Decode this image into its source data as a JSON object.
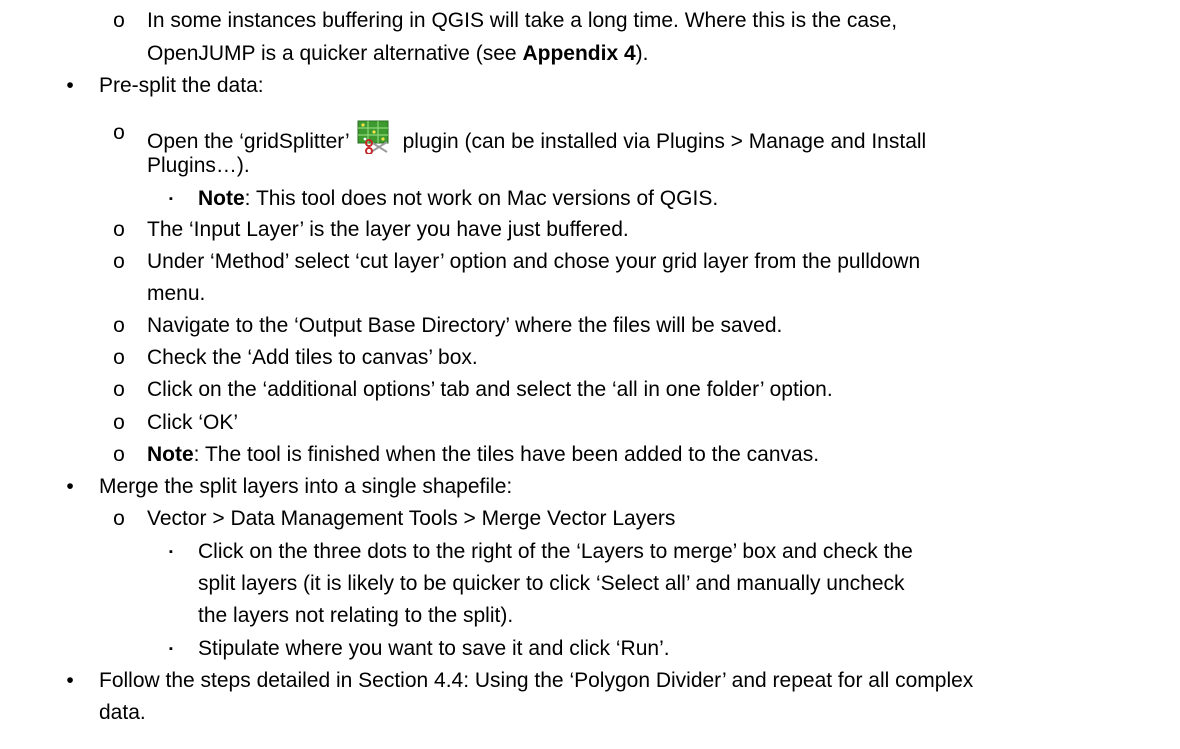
{
  "bullets": {
    "level1": "•",
    "level2": "o",
    "level3": "▪"
  },
  "intro": {
    "line1": "In some instances buffering in QGIS will take a long time.  Where this is the case,",
    "line2_pre": "OpenJUMP is a quicker alternative (see ",
    "line2_bold": "Appendix 4",
    "line2_post": ")."
  },
  "presplit": {
    "heading": "Pre-split the data:",
    "open_pre": "Open the ‘gridSplitter’ ",
    "open_post": " plugin (can be installed via Plugins > Manage and Install",
    "open_cont": "Plugins…).",
    "note_bold": "Note",
    "note_text": ": This tool does not work on Mac versions of QGIS.",
    "input_layer": "The ‘Input Layer’ is the layer you have just buffered.",
    "method_1": "Under ‘Method’ select ‘cut layer’ option and chose your grid layer from the pulldown",
    "method_2": "menu.",
    "navigate": "Navigate to the ‘Output Base Directory’ where the files will be saved.",
    "check": "Check the ‘Add tiles to canvas’ box.",
    "additional": "Click on the ‘additional options’ tab and select the ‘all in one folder’ option.",
    "ok": "Click ‘OK’",
    "note2_bold": "Note",
    "note2_text": ": The tool is finished when the tiles have been added to the canvas."
  },
  "merge": {
    "heading": "Merge the split layers into a single shapefile:",
    "path": "Vector > Data Management Tools > Merge Vector Layers",
    "step1_1": "Click on the three dots to the right of the ‘Layers to merge’ box and check the",
    "step1_2": "split layers (it is likely to be quicker to click ‘Select all’ and manually uncheck",
    "step1_3": "the layers not relating to the split).",
    "step2": "Stipulate where you want to save it and click ‘Run’."
  },
  "follow": {
    "line1": "Follow the steps detailed in Section 4.4: Using the ‘Polygon Divider’ and repeat for all complex",
    "line2": "data."
  },
  "icon_names": [
    "grid-splitter-plugin-icon"
  ],
  "colors": {
    "text": "#000000",
    "icon_green": "#3c9a2e",
    "icon_red": "#c8282a"
  }
}
